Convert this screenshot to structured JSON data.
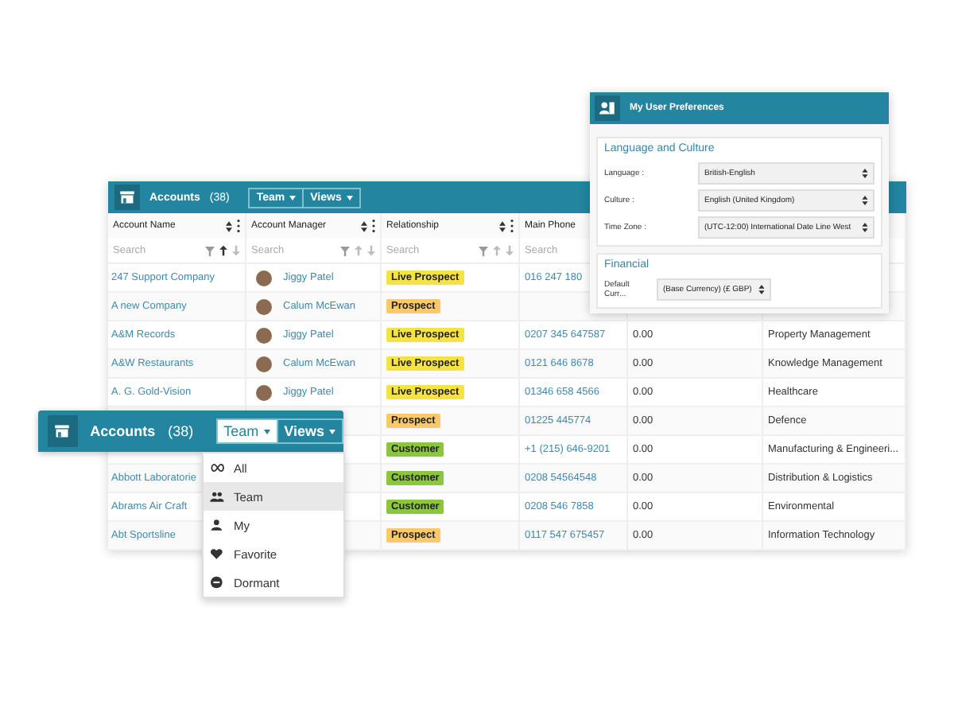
{
  "grid": {
    "title": "Accounts",
    "count": "(38)",
    "buttons": [
      {
        "label": "Team",
        "open": false
      },
      {
        "label": "Views",
        "open": false
      }
    ],
    "columns": [
      {
        "label": "Account Name",
        "search": "Search",
        "sorted_ascending": true
      },
      {
        "label": "Account Manager",
        "search": "Search",
        "sorted_ascending": false
      },
      {
        "label": "Relationship",
        "search": "Search",
        "sorted_ascending": false
      },
      {
        "label": "Main Phone",
        "search": "Search"
      }
    ],
    "rows": [
      {
        "name": "247 Support Company",
        "manager": "Jiggy Patel",
        "relationship": {
          "label": "Live Prospect",
          "color": "#f5e342"
        },
        "phone": "016 247 180"
      },
      {
        "name": "A new Company",
        "manager": "Calum McEwan",
        "relationship": {
          "label": "Prospect",
          "color": "#f9c96a"
        }
      },
      {
        "name": "A&M Records",
        "manager": "Jiggy Patel",
        "relationship": {
          "label": "Live Prospect",
          "color": "#f5e342"
        },
        "phone": "0207 345 647587",
        "amount": "0.00",
        "industry": "Property Management"
      },
      {
        "name": "A&W Restaurants",
        "manager": "Calum McEwan",
        "relationship": {
          "label": "Live Prospect",
          "color": "#f5e342"
        },
        "phone": "0121 646 8678",
        "amount": "0.00",
        "industry": "Knowledge Management"
      },
      {
        "name": "A. G. Gold-Vision",
        "manager": "Jiggy Patel",
        "relationship": {
          "label": "Live Prospect",
          "color": "#f5e342"
        },
        "phone": "01346 658 4566",
        "amount": "0.00",
        "industry": "Healthcare"
      },
      {
        "relationship": {
          "label": "Prospect",
          "color": "#f9c96a"
        },
        "phone": "01225 445774",
        "amount": "0.00",
        "industry": "Defence"
      },
      {
        "relationship": {
          "label": "Customer",
          "color": "#8cc63e"
        },
        "phone": "+1 (215) 646-9201",
        "amount": "0.00",
        "industry": "Manufacturing & Engineeri..."
      },
      {
        "name": "Abbott Laboratorie",
        "relationship": {
          "label": "Customer",
          "color": "#8cc63e"
        },
        "phone": "0208 54564548",
        "amount": "0.00",
        "industry": "Distribution & Logistics"
      },
      {
        "name": "Abrams Air Craft",
        "relationship": {
          "label": "Customer",
          "color": "#8cc63e"
        },
        "phone": "0208 546 7858",
        "amount": "0.00",
        "industry": "Environmental"
      },
      {
        "name": "Abt Sportsline",
        "relationship": {
          "label": "Prospect",
          "color": "#f9c96a"
        },
        "phone": "0117 547 675457",
        "amount": "0.00",
        "industry": "Information Technology"
      }
    ]
  },
  "preferences": {
    "title": "My User Preferences",
    "sections": [
      {
        "title": "Language and Culture",
        "fields": [
          {
            "label": "Language :",
            "value": "British-English"
          },
          {
            "label": "Culture :",
            "value": "English (United Kingdom)"
          },
          {
            "label": "Time Zone :",
            "value": "(UTC-12:00) International Date Line West"
          }
        ]
      },
      {
        "title": "Financial",
        "fields": [
          {
            "label": "Default Curr...",
            "value": "(Base Currency) (£ GBP)"
          }
        ]
      }
    ]
  },
  "zoomed_bar": {
    "title": "Accounts",
    "count": "(38)",
    "buttons": [
      {
        "label": "Team",
        "open": true
      },
      {
        "label": "Views",
        "open": false
      }
    ],
    "menu": [
      {
        "kind": "all",
        "label": "All",
        "selected": false
      },
      {
        "kind": "team",
        "label": "Team",
        "selected": true
      },
      {
        "kind": "my",
        "label": "My",
        "selected": false
      },
      {
        "kind": "favorite",
        "label": "Favorite",
        "selected": false
      },
      {
        "kind": "dormant",
        "label": "Dormant",
        "selected": false
      }
    ]
  }
}
